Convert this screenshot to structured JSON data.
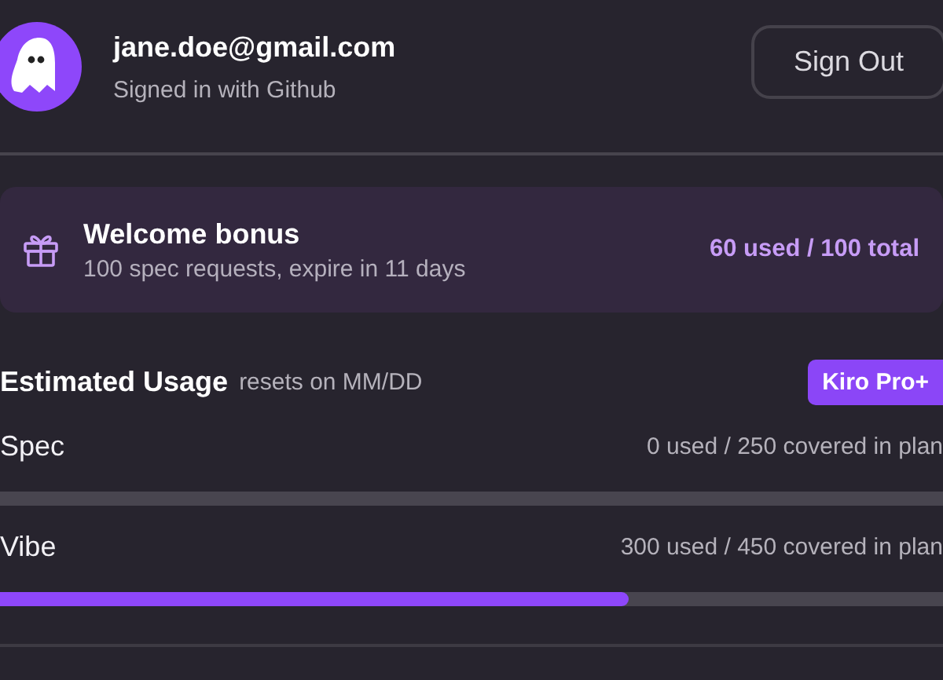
{
  "account": {
    "email": "jane.doe@gmail.com",
    "subtitle": "Signed in with Github",
    "sign_out": "Sign Out"
  },
  "bonus": {
    "title": "Welcome bonus",
    "subtitle": "100 spec requests, expire in 11 days",
    "usage": "60 used / 100 total"
  },
  "usage": {
    "title": "Estimated Usage",
    "resets": "resets on MM/DD",
    "plan_badge": "Kiro Pro+",
    "meters": [
      {
        "name": "Spec",
        "reading": "0 used / 250 covered in plan",
        "level": 0
      },
      {
        "name": "Vibe",
        "reading": "300 used / 450 covered in plan",
        "level": 0.667
      }
    ]
  }
}
